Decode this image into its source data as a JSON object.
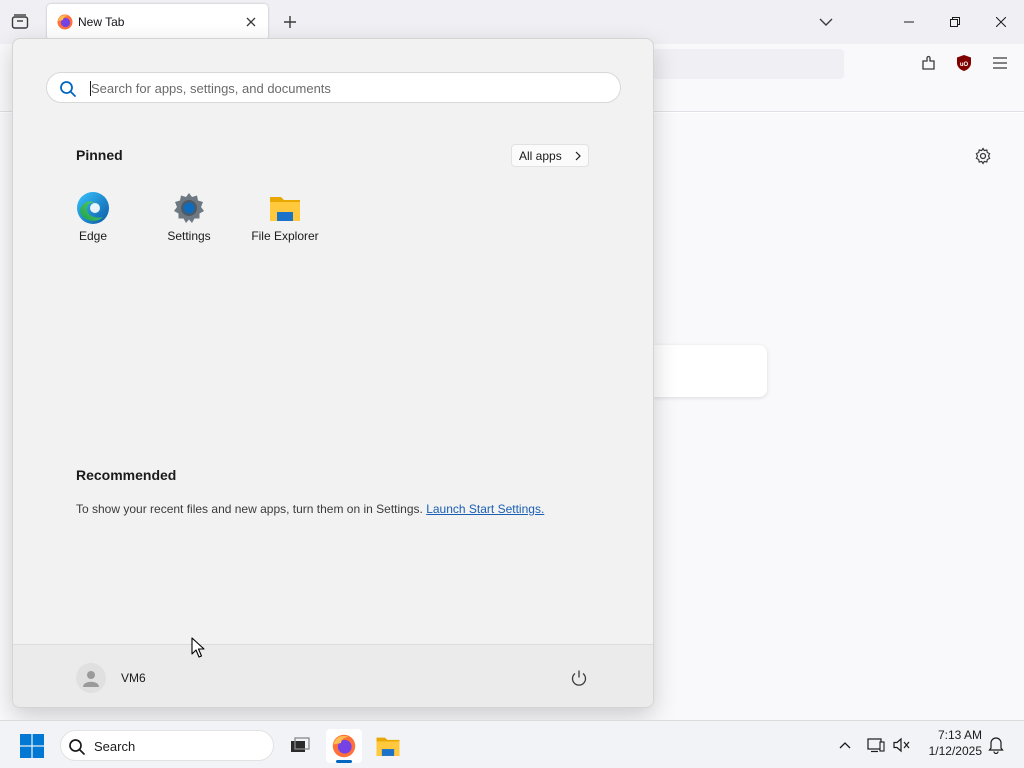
{
  "browser": {
    "tab": {
      "title": "New Tab",
      "favicon": "firefox-icon",
      "close_icon": "close-icon"
    },
    "tab_list_icon": "tab-list-icon",
    "new_tab_icon": "plus-icon",
    "tab_overflow_icon": "chevron-down-icon",
    "window_controls": {
      "minimize": "minimize-icon",
      "maximize": "restore-icon",
      "close": "close-icon"
    },
    "toolbar_icons": [
      "extensions-icon",
      "ublock-origin-icon",
      "hamburger-menu-icon"
    ],
    "content": {
      "settings_icon": "gear-icon"
    }
  },
  "start_menu": {
    "search": {
      "placeholder": "Search for apps, settings, and documents",
      "value": ""
    },
    "pinned": {
      "title": "Pinned",
      "all_apps_label": "All apps",
      "apps": [
        {
          "label": "Edge",
          "icon": "edge-icon"
        },
        {
          "label": "Settings",
          "icon": "settings-gear-icon"
        },
        {
          "label": "File Explorer",
          "icon": "folder-icon"
        }
      ]
    },
    "recommended": {
      "title": "Recommended",
      "message": "To show your recent files and new apps, turn them on in Settings.",
      "link_label": "Launch Start Settings."
    },
    "footer": {
      "user_name": "VM6",
      "power_icon": "power-icon"
    }
  },
  "taskbar": {
    "search_label": "Search",
    "apps": [
      "windows-start-icon",
      "task-view-icon",
      "firefox-icon",
      "file-explorer-icon"
    ],
    "tray": {
      "time": "7:13 AM",
      "date": "1/12/2025"
    }
  },
  "colors": {
    "accent": "#0067c0",
    "link": "#1a5fb4",
    "start_menu_bg": "#f2f2f2",
    "taskbar_bg": "#f1f3f6"
  }
}
